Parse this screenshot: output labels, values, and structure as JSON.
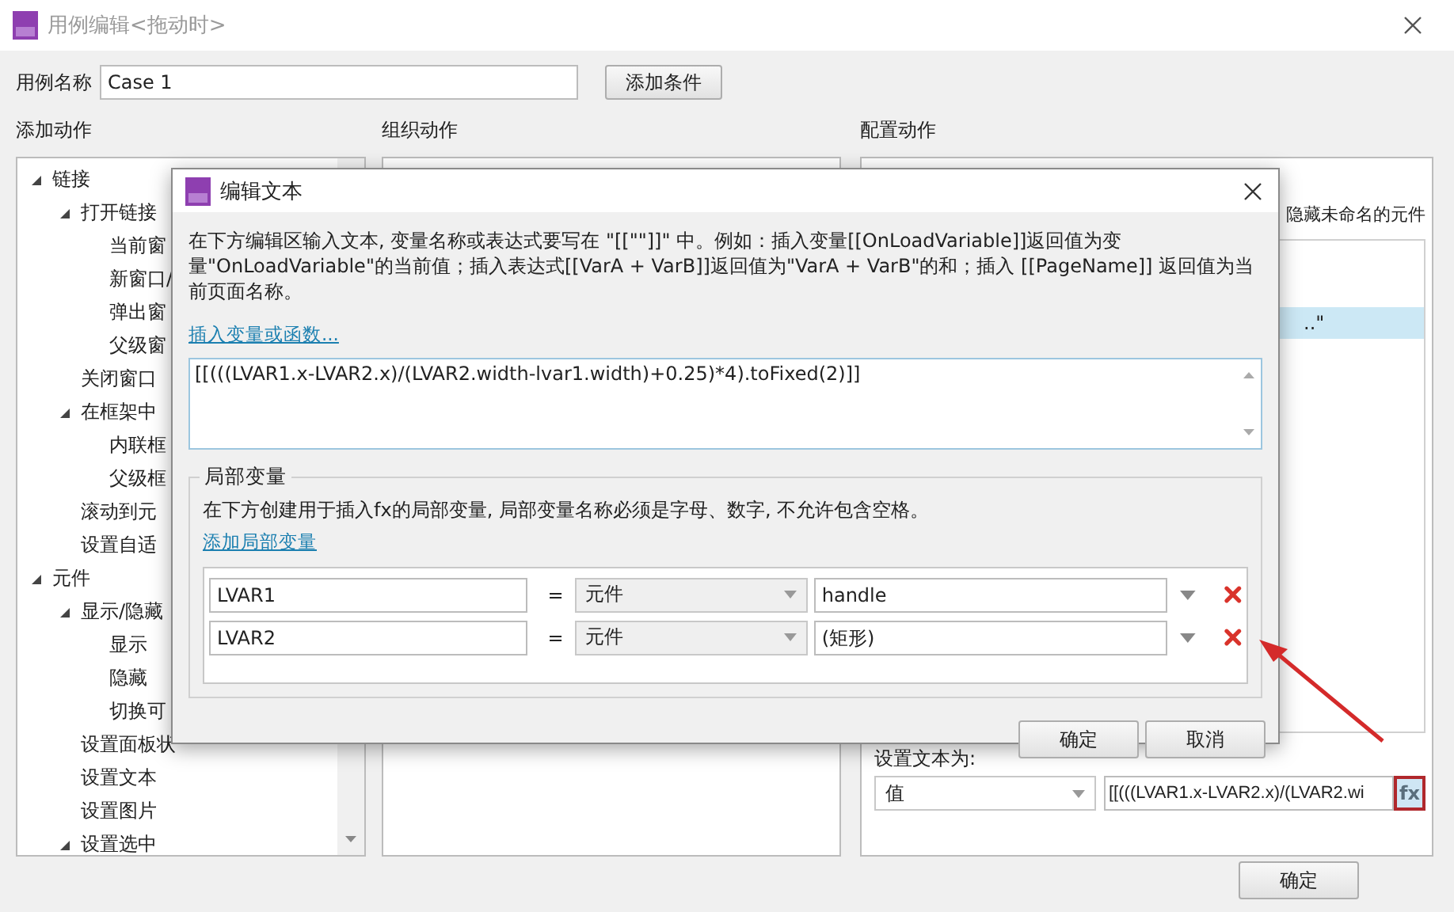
{
  "window": {
    "title": "用例编辑<拖动时>"
  },
  "case_name": {
    "label": "用例名称",
    "value": "Case 1"
  },
  "add_condition_button": "添加条件",
  "add_actions": {
    "title": "添加动作",
    "tree": [
      {
        "label": "链接",
        "expanded": true,
        "children": [
          {
            "label": "打开链接",
            "expanded": true,
            "children": [
              {
                "label": "当前窗"
              },
              {
                "label": "新窗口/"
              },
              {
                "label": "弹出窗"
              },
              {
                "label": "父级窗"
              }
            ]
          },
          {
            "label": "关闭窗口"
          },
          {
            "label": "在框架中",
            "expanded": true,
            "children": [
              {
                "label": "内联框"
              },
              {
                "label": "父级框"
              }
            ]
          },
          {
            "label": "滚动到元"
          },
          {
            "label": "设置自适"
          }
        ]
      },
      {
        "label": "元件",
        "expanded": true,
        "children": [
          {
            "label": "显示/隐藏",
            "expanded": true,
            "children": [
              {
                "label": "显示"
              },
              {
                "label": "隐藏"
              },
              {
                "label": "切换可"
              }
            ]
          },
          {
            "label": "设置面板状"
          },
          {
            "label": "设置文本"
          },
          {
            "label": "设置图片"
          },
          {
            "label": "设置选中",
            "expanded": true
          }
        ]
      }
    ]
  },
  "organize_actions": {
    "title": "组织动作"
  },
  "configure_actions": {
    "title": "配置动作",
    "hide_unnamed_label": "隐藏未命名的元件",
    "list_rows": [
      {
        "text": "..\"",
        "selected": true
      }
    ],
    "set_text_label": "设置文本为:",
    "value_type": "值",
    "value": "[[(((LVAR1.x-LVAR2.x)/(LVAR2.wi",
    "fx_button": "fx"
  },
  "footer_button": "确定",
  "dialog": {
    "title": "编辑文本",
    "description": "在下方编辑区输入文本, 变量名称或表达式要写在 \"[[\"\"]]\" 中。例如：插入变量[[OnLoadVariable]]返回值为变量\"OnLoadVariable\"的当前值；插入表达式[[VarA + VarB]]返回值为\"VarA + VarB\"的和；插入 [[PageName]] 返回值为当前页面名称。",
    "insert_link": "插入变量或函数...",
    "expression": "[[(((LVAR1.x-LVAR2.x)/(LVAR2.width-lvar1.width)+0.25)*4).toFixed(2)]]",
    "local_vars": {
      "title": "局部变量",
      "hint": "在下方创建用于插入fx的局部变量, 局部变量名称必须是字母、数字, 不允许包含空格。",
      "add_link": "添加局部变量",
      "rows": [
        {
          "name": "LVAR1",
          "equals": "=",
          "type": "元件",
          "target": "handle"
        },
        {
          "name": "LVAR2",
          "equals": "=",
          "type": "元件",
          "target": "(矩形)"
        }
      ]
    },
    "ok": "确定",
    "cancel": "取消"
  }
}
